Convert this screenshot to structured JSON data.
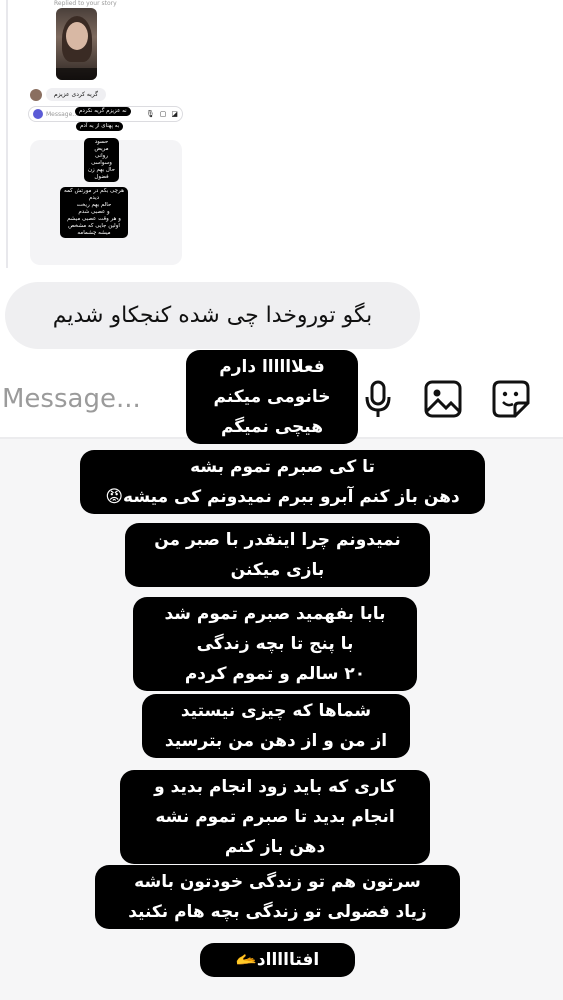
{
  "preview": {
    "replied_label": "Replied to your story",
    "reply_text": "گریه کردی عزیزم",
    "input_placeholder": "Message...",
    "captions": [
      "نه عزیزم گریه نکردم",
      "به پهنای از یه آدم",
      "حسود\nمریض\nروانی\nوسواسی\nحال بهم زن\nفضول",
      "هرچی بکم در مورتش کمه\nدیدم\nحالم بهم ریخت\nو عصبی شدم\nو هر وقت عصبی میشم\nاولین جایی که مشخص\nمیشه چشمامه"
    ]
  },
  "thread": {
    "sent_message": "بگو توروخدا چی شده کنجکاو شدیم"
  },
  "composer": {
    "placeholder": "Message...",
    "mic_icon": "microphone-icon",
    "gallery_icon": "image-icon",
    "sticker_icon": "sticker-icon"
  },
  "captions": [
    "فعلاااااا دارم\nخانومی میکنم\nهیچی نمیگم",
    "تا کی صبرم تموم بشه\nدهن باز کنم آبرو ببرم نمیدونم کی میشه😡",
    "نمیدونم چرا اینقدر با صبر من\nبازی میکنن",
    "بابا بفهمید صبرم تموم شد\nبا پنج تا بچه زندگی\n۲۰ سالم و تموم کردم",
    "شماها که چیزی نیستید\nاز من و از دهن من بترسید",
    "کاری که باید زود انجام بدید و\nانجام بدید تا صبرم تموم نشه\nدهن باز کنم",
    "سرتون هم تو زندگی خودتون باشه\nزیاد فضولی تو زندگی بچه هام نکنید",
    "افتاااااد🫴"
  ]
}
